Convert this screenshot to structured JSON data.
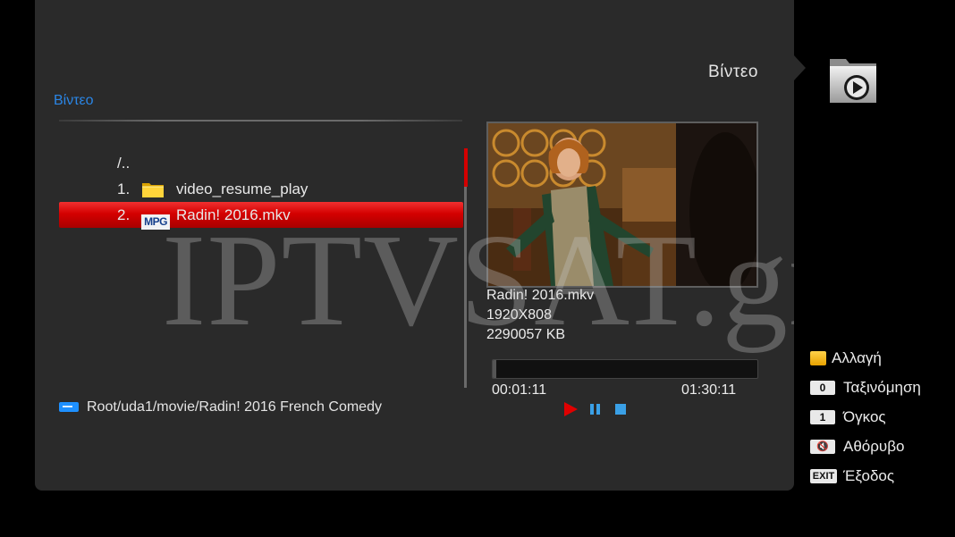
{
  "header": {
    "title": "Βίντεο"
  },
  "section": {
    "title": "Βίντεο"
  },
  "file_list": {
    "up_label": "/..",
    "items": [
      {
        "number": "1.",
        "type": "folder-icon",
        "name": "video_resume_play",
        "selected": false
      },
      {
        "number": "2.",
        "type": "mpg",
        "badge": "MPG",
        "name": "Radin! 2016.mkv",
        "selected": true
      }
    ]
  },
  "path": "Root/uda1/movie/Radin! 2016 French Comedy",
  "preview_info": {
    "filename": "Radin! 2016.mkv",
    "resolution": "1920X808",
    "size": "2290057 KB"
  },
  "playback": {
    "current_time": "00:01:11",
    "total_time": "01:30:11",
    "progress_fraction": 0.013
  },
  "legend": [
    {
      "key": "yellow-button",
      "key_label": "",
      "label": "Αλλαγή"
    },
    {
      "key": "0-button",
      "key_label": "0",
      "label": "Ταξινόμηση"
    },
    {
      "key": "1-button",
      "key_label": "1",
      "label": "Όγκος"
    },
    {
      "key": "mute-button",
      "key_label": "🔇",
      "label": "Αθόρυβο"
    },
    {
      "key": "exit-button",
      "key_label": "EXIT",
      "label": "Έξοδος"
    }
  ],
  "watermark": "IPTVSAT.gr",
  "colors": {
    "panel": "#2a2a2a",
    "accent_blue": "#2a86e6",
    "selection_red": "#d40000",
    "control_blue": "#3aa0e6"
  }
}
